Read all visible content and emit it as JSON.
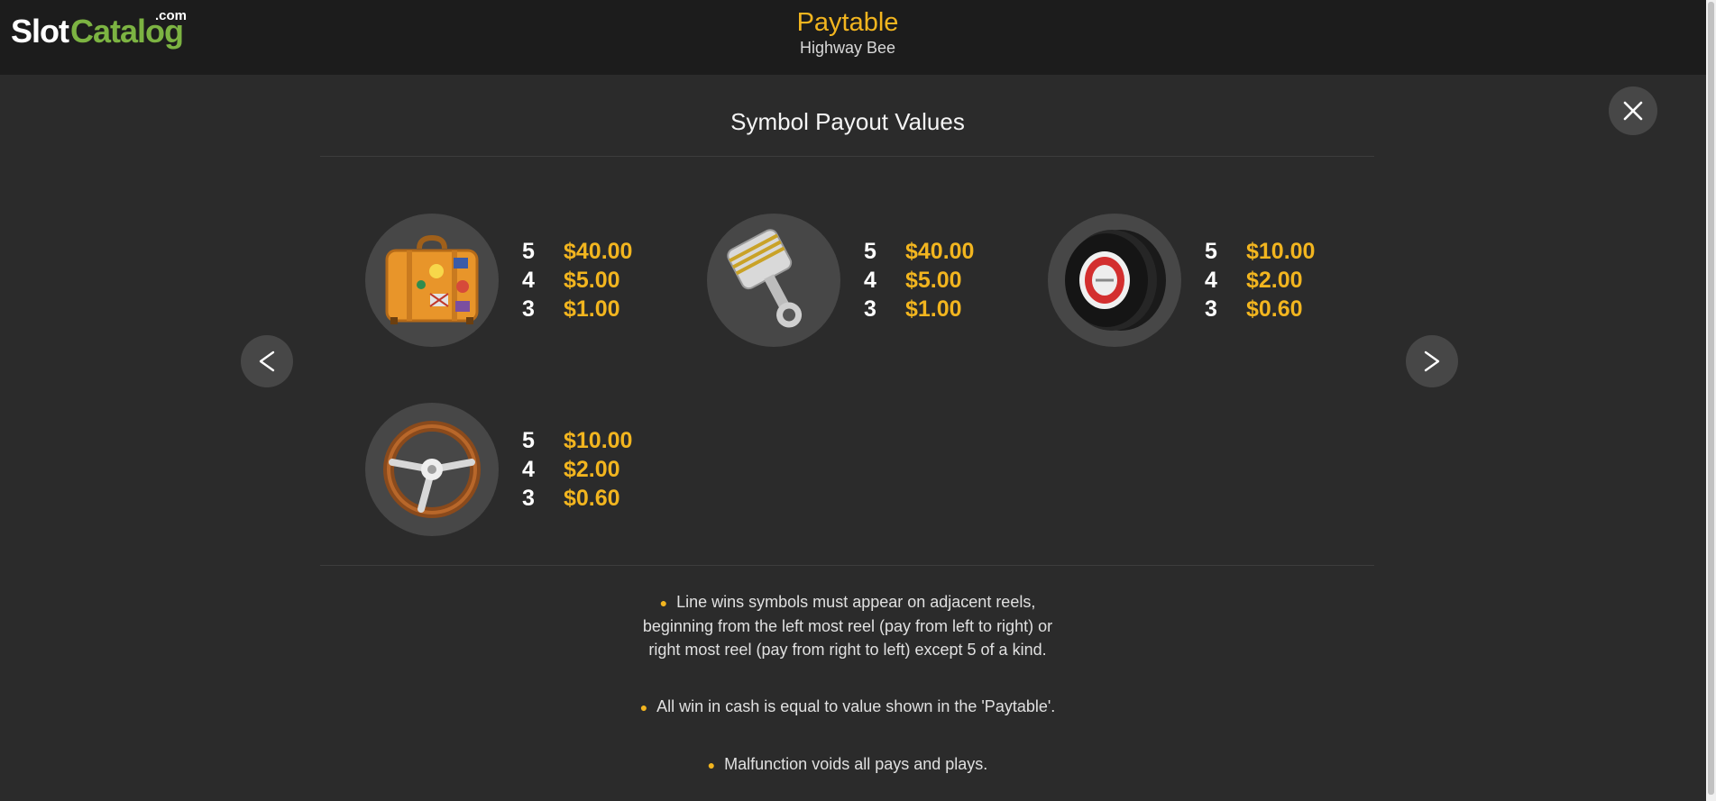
{
  "logo": {
    "slot": "Slot",
    "catalog": "Catalog",
    "com": ".com"
  },
  "header": {
    "title": "Paytable",
    "subtitle": "Highway Bee"
  },
  "section_title": "Symbol Payout Values",
  "nav": {
    "prev": "<",
    "next": ">"
  },
  "symbols": [
    {
      "icon": "suitcase-icon",
      "pays": [
        {
          "count": "5",
          "value": "$40.00"
        },
        {
          "count": "4",
          "value": "$5.00"
        },
        {
          "count": "3",
          "value": "$1.00"
        }
      ]
    },
    {
      "icon": "piston-icon",
      "pays": [
        {
          "count": "5",
          "value": "$40.00"
        },
        {
          "count": "4",
          "value": "$5.00"
        },
        {
          "count": "3",
          "value": "$1.00"
        }
      ]
    },
    {
      "icon": "tire-icon",
      "pays": [
        {
          "count": "5",
          "value": "$10.00"
        },
        {
          "count": "4",
          "value": "$2.00"
        },
        {
          "count": "3",
          "value": "$0.60"
        }
      ]
    },
    {
      "icon": "steering-wheel-icon",
      "pays": [
        {
          "count": "5",
          "value": "$10.00"
        },
        {
          "count": "4",
          "value": "$2.00"
        },
        {
          "count": "3",
          "value": "$0.60"
        }
      ]
    }
  ],
  "rules": [
    {
      "lines": [
        "Line wins symbols must appear on adjacent reels,",
        "beginning from the left most reel (pay from left to right) or",
        "right most reel (pay from right to left) except 5 of a kind."
      ]
    },
    {
      "lines": [
        "All win in cash is equal to value shown in the 'Paytable'."
      ]
    },
    {
      "lines": [
        "Malfunction voids all pays and plays."
      ]
    }
  ],
  "colors": {
    "accent": "#f2b51f",
    "background": "#2b2b2b",
    "header": "#1c1c1c",
    "logo_green": "#7cb342"
  }
}
